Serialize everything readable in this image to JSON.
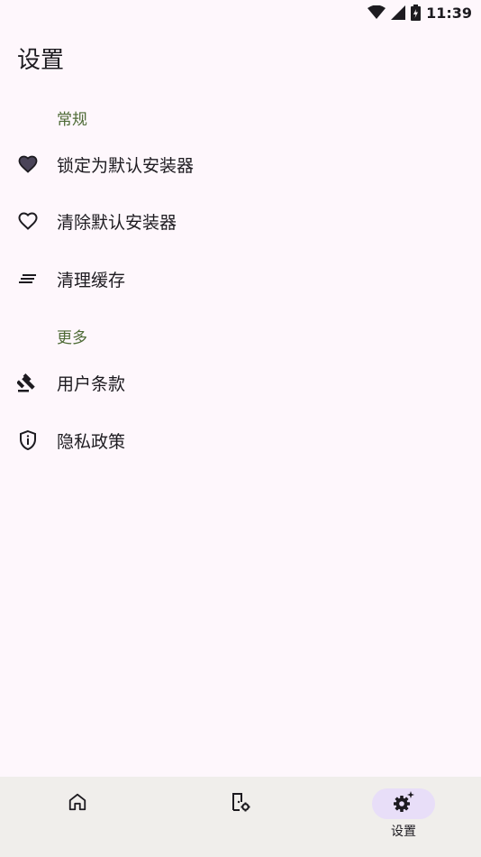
{
  "status_bar": {
    "time": "11:39",
    "icons": [
      "wifi-icon",
      "cellular-signal-icon",
      "battery-charging-icon"
    ]
  },
  "header": {
    "title": "设置"
  },
  "sections": [
    {
      "title": "常规",
      "items": [
        {
          "label": "锁定为默认安装器",
          "icon": "heart-filled-icon"
        },
        {
          "label": "清除默认安装器",
          "icon": "heart-outline-icon"
        },
        {
          "label": "清理缓存",
          "icon": "clear-all-icon"
        }
      ]
    },
    {
      "title": "更多",
      "items": [
        {
          "label": "用户条款",
          "icon": "gavel-icon"
        },
        {
          "label": "隐私政策",
          "icon": "shield-info-icon"
        }
      ]
    }
  ],
  "bottom_nav": {
    "items": [
      {
        "icon": "home-icon",
        "label": ""
      },
      {
        "icon": "installer-settings-icon",
        "label": ""
      },
      {
        "icon": "settings-sparkle-icon",
        "label": "设置",
        "active": true
      }
    ]
  },
  "colors": {
    "background": "#FEF7FC",
    "section_header": "#4D6A35",
    "nav_background": "#F0EEEB",
    "nav_active_pill": "#E8DEF8"
  }
}
